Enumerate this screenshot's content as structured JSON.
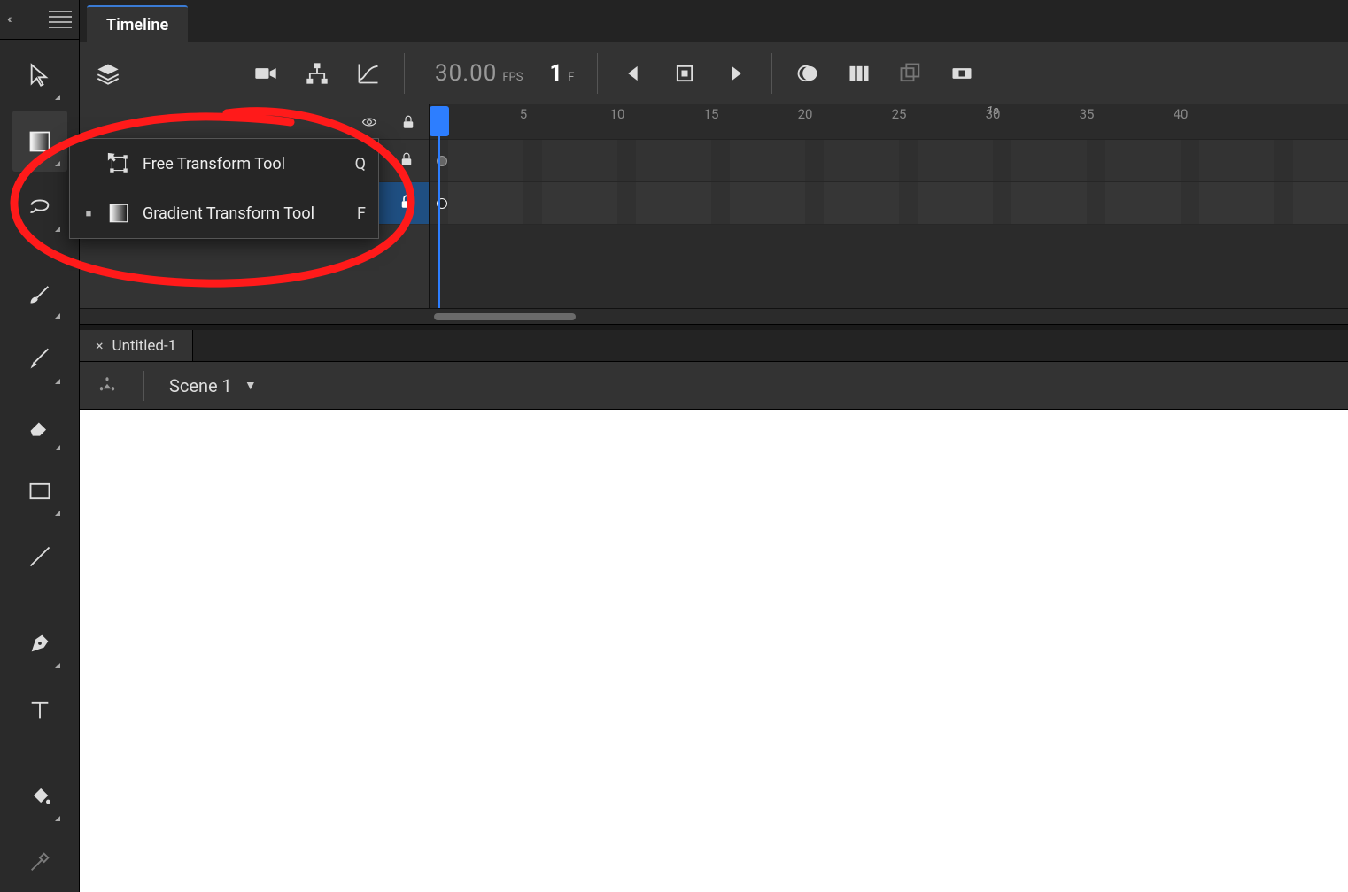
{
  "panel": {
    "timeline_label": "Timeline"
  },
  "timeline": {
    "fps_value": "30.00",
    "fps_label": "FPS",
    "frame_value": "1",
    "frame_label": "F",
    "seconds_label": "1s",
    "ruler_marks": [
      "5",
      "10",
      "15",
      "20",
      "25",
      "30",
      "35",
      "40"
    ]
  },
  "layers": [
    {
      "name": "",
      "selected": false,
      "locked": true
    },
    {
      "name": "",
      "selected": true,
      "locked": true
    }
  ],
  "document": {
    "tab_name": "Untitled-1",
    "scene_name": "Scene 1"
  },
  "flyout": {
    "items": [
      {
        "label": "Free Transform Tool",
        "shortcut": "Q",
        "current": false
      },
      {
        "label": "Gradient Transform Tool",
        "shortcut": "F",
        "current": true
      }
    ]
  }
}
